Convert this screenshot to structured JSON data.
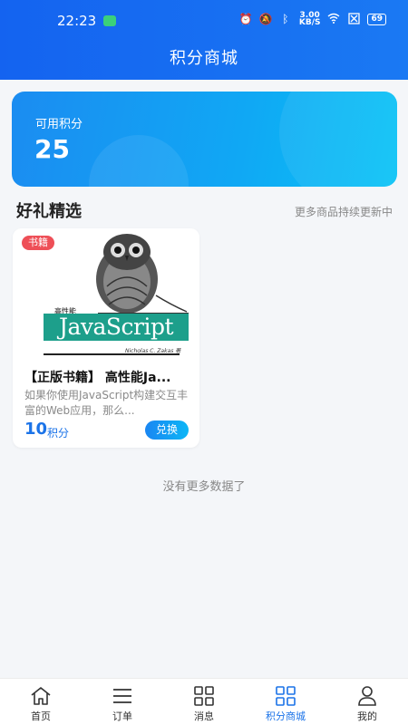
{
  "status_bar": {
    "time": "22:23",
    "speed_top": "3.00",
    "speed_unit": "KB/S",
    "battery": "69"
  },
  "header": {
    "title": "积分商城"
  },
  "points": {
    "label": "可用积分",
    "value": "25"
  },
  "section": {
    "title": "好礼精选",
    "more": "更多商品持续更新中"
  },
  "products": [
    {
      "tag": "书籍",
      "title": "【正版书籍】 高性能Ja...",
      "description": "如果你使用JavaScript构建交互丰富的Web应用，那么...",
      "cover": {
        "subtitle": "高性能",
        "banner": "JavaScript",
        "author": "Nicholas C. Zakas 著"
      },
      "price_value": "10",
      "price_unit": "积分",
      "button": "兑换"
    }
  ],
  "footer_text": "没有更多数据了",
  "nav": [
    {
      "label": "首页",
      "icon": "home-icon"
    },
    {
      "label": "订单",
      "icon": "list-icon"
    },
    {
      "label": "消息",
      "icon": "grid-icon"
    },
    {
      "label": "积分商城",
      "icon": "grid-icon"
    },
    {
      "label": "我的",
      "icon": "user-icon"
    }
  ],
  "colors": {
    "primary": "#1463f0",
    "accent": "#1b73e8",
    "tag": "#ee4f57"
  }
}
